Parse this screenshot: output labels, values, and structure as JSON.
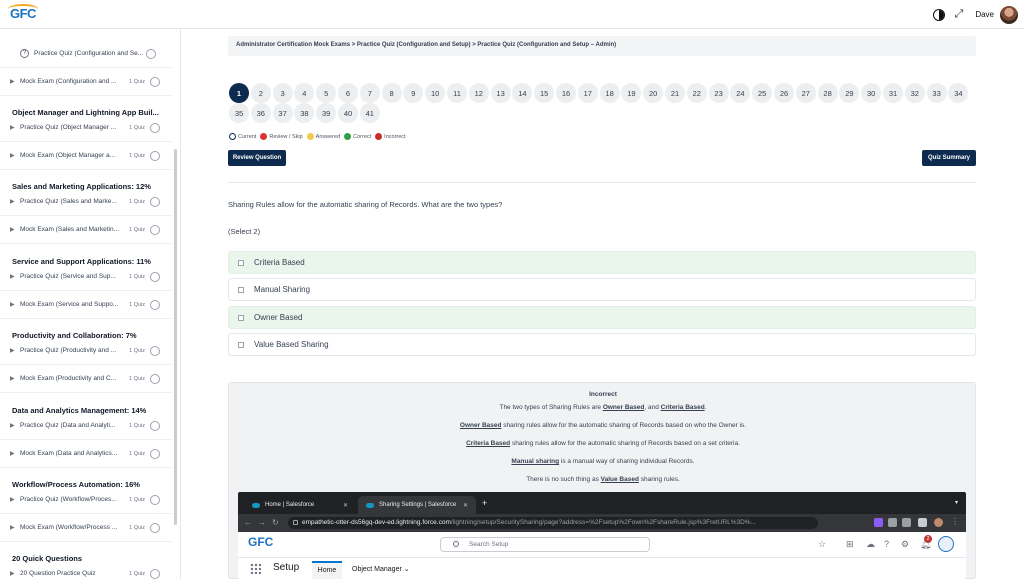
{
  "header": {
    "username": "Dave"
  },
  "sidebar": {
    "items": [
      {
        "type": "lesson",
        "title": "Practice Quiz (Configuration and Se...",
        "count": ""
      },
      {
        "type": "quiz",
        "title": "Mock Exam (Configuration and ...",
        "count": "1 Quiz"
      },
      {
        "type": "heading",
        "title": "Object Manager and Lightning App Buil..."
      },
      {
        "type": "quiz",
        "title": "Practice Quiz (Object Manager ...",
        "count": "1 Quiz"
      },
      {
        "type": "quiz",
        "title": "Mock Exam (Object Manager a...",
        "count": "1 Quiz"
      },
      {
        "type": "heading",
        "title": "Sales and Marketing Applications: 12%"
      },
      {
        "type": "quiz",
        "title": "Practice Quiz (Sales and Marke...",
        "count": "1 Quiz"
      },
      {
        "type": "quiz",
        "title": "Mock Exam (Sales and Marketin...",
        "count": "1 Quiz"
      },
      {
        "type": "heading",
        "title": "Service and Support Applications: 11%"
      },
      {
        "type": "quiz",
        "title": "Practice Quiz (Service and Sup...",
        "count": "1 Quiz"
      },
      {
        "type": "quiz",
        "title": "Mock Exam (Service and Suppo...",
        "count": "1 Quiz"
      },
      {
        "type": "heading",
        "title": "Productivity and Collaboration: 7%"
      },
      {
        "type": "quiz",
        "title": "Practice Quiz (Productivity and ...",
        "count": "1 Quiz"
      },
      {
        "type": "quiz",
        "title": "Mock Exam (Productivity and C...",
        "count": "1 Quiz"
      },
      {
        "type": "heading",
        "title": "Data and Analytics Management: 14%"
      },
      {
        "type": "quiz",
        "title": "Practice Quiz (Data and Analyti...",
        "count": "1 Quiz"
      },
      {
        "type": "quiz",
        "title": "Mock Exam (Data and Analytics...",
        "count": "1 Quiz"
      },
      {
        "type": "heading",
        "title": "Workflow/Process Automation: 16%"
      },
      {
        "type": "quiz",
        "title": "Practice Quiz (Workflow/Proces...",
        "count": "1 Quiz"
      },
      {
        "type": "quiz",
        "title": "Mock Exam (Workflow/Process ...",
        "count": "1 Quiz"
      },
      {
        "type": "heading",
        "title": "20 Quick Questions"
      },
      {
        "type": "quiz",
        "title": "20 Question Practice Quiz",
        "count": "1 Quiz"
      }
    ]
  },
  "main": {
    "breadcrumb": "Administrator Certification Mock Exams > Practice Quiz (Configuration and Setup) > Practice Quiz (Configuration and Setup – Admin)",
    "question_numbers": [
      "1",
      "2",
      "3",
      "4",
      "5",
      "6",
      "7",
      "8",
      "9",
      "10",
      "11",
      "12",
      "13",
      "14",
      "15",
      "16",
      "17",
      "18",
      "19",
      "20",
      "21",
      "22",
      "23",
      "24",
      "25",
      "26",
      "27",
      "28",
      "29",
      "30",
      "31",
      "32",
      "33",
      "34",
      "35",
      "36",
      "37",
      "38",
      "39",
      "40",
      "41"
    ],
    "current_question": "1",
    "legend": [
      {
        "label": "Current",
        "color": "#ffffff"
      },
      {
        "label": "Review / Skip",
        "color": "#e03131"
      },
      {
        "label": "Answered",
        "color": "#f2c94c"
      },
      {
        "label": "Correct",
        "color": "#2f9e44"
      },
      {
        "label": "Incorrect",
        "color": "#c92a2a"
      }
    ],
    "review_button": "Review Question",
    "summary_button": "Quiz Summary",
    "question": "Sharing Rules allow for the automatic sharing of Records. What are the two types?",
    "select_hint": "(Select 2)",
    "options": [
      {
        "label": "Criteria Based",
        "correct": true
      },
      {
        "label": "Manual Sharing",
        "correct": false
      },
      {
        "label": "Owner Based",
        "correct": true
      },
      {
        "label": "Value Based Sharing",
        "correct": false
      }
    ],
    "feedback": {
      "status": "Incorrect",
      "l1_pre": "The two types of Sharing Rules are ",
      "l1_a": "Owner Based",
      "l1_mid": ", and ",
      "l1_b": "Criteria Based",
      "l1_post": ".",
      "l2_b": "Owner Based",
      "l2_post": " sharing rules allow for the automatic sharing of Records based on who the Owner is.",
      "l3_b": "Criteria Based",
      "l3_post": " sharing rules allow for the automatic sharing of Records based on a set criteria.",
      "l4_b": "Manual sharing",
      "l4_post": " is a manual way of sharing individual Records.",
      "l5_pre": "There is no such thing as ",
      "l5_b": "Value Based",
      "l5_post": " sharing rules."
    },
    "screenshot": {
      "tab1": "Home | Salesforce",
      "tab2": "Sharing Settings | Salesforce",
      "url_host": "empathetic-otter-ds56gq-dev-ed.lightning.force.com",
      "url_path": "/lightning/setup/SecuritySharing/page?address=%2Fsetup%2Fown%2FshareRule.jsp%3FretURL%3D%...",
      "search_placeholder": "Search Setup",
      "app_name": "Setup",
      "nav_home": "Home",
      "nav_object_manager": "Object Manager",
      "logo_text": "GFC",
      "notification_count": "2"
    }
  }
}
